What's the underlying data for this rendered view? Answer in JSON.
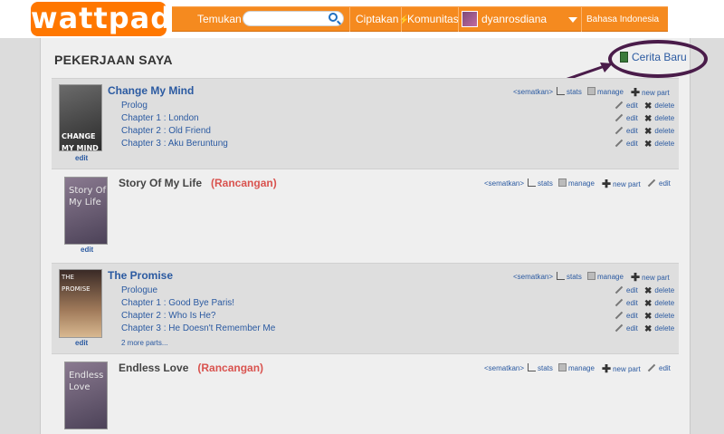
{
  "header": {
    "logo": "wattpad",
    "search_label": "Temukan",
    "search_placeholder": "",
    "create": "Ciptakan",
    "community": "Komunitas",
    "username": "dyanrosdiana",
    "language": "Bahasa Indonesia"
  },
  "page": {
    "title": "PEKERJAAN SAYA",
    "new_story": "Cerita Baru"
  },
  "labels": {
    "embed": "<sematkan>",
    "stats": "stats",
    "manage": "manage",
    "new_part": "new part",
    "edit": "edit",
    "delete": "delete",
    "draft": "(Rancangan)"
  },
  "stories": [
    {
      "title": "Change My Mind",
      "cover_text": "CHANGE MY MIND",
      "status": "published",
      "parts": [
        "Prolog",
        "Chapter 1 : London",
        "Chapter 2 : Old Friend",
        "Chapter 3 : Aku Beruntung"
      ]
    },
    {
      "title": "Story Of My Life",
      "cover_text": "Story Of My Life",
      "status": "draft"
    },
    {
      "title": "The Promise",
      "cover_text": "THE PROMISE",
      "status": "published",
      "parts": [
        "Prologue",
        "Chapter 1 : Good Bye Paris!",
        "Chapter 2 : Who Is He?",
        "Chapter 3 : He Doesn't Remember Me"
      ],
      "more_parts": "2 more parts..."
    },
    {
      "title": "Endless Love",
      "cover_text": "Endless Love",
      "status": "draft"
    }
  ],
  "colors": {
    "brand_orange": "#f58a1f",
    "link_blue": "#2b5aa1",
    "draft_red": "#d9534f",
    "annotation_purple": "#4a1c4a"
  }
}
